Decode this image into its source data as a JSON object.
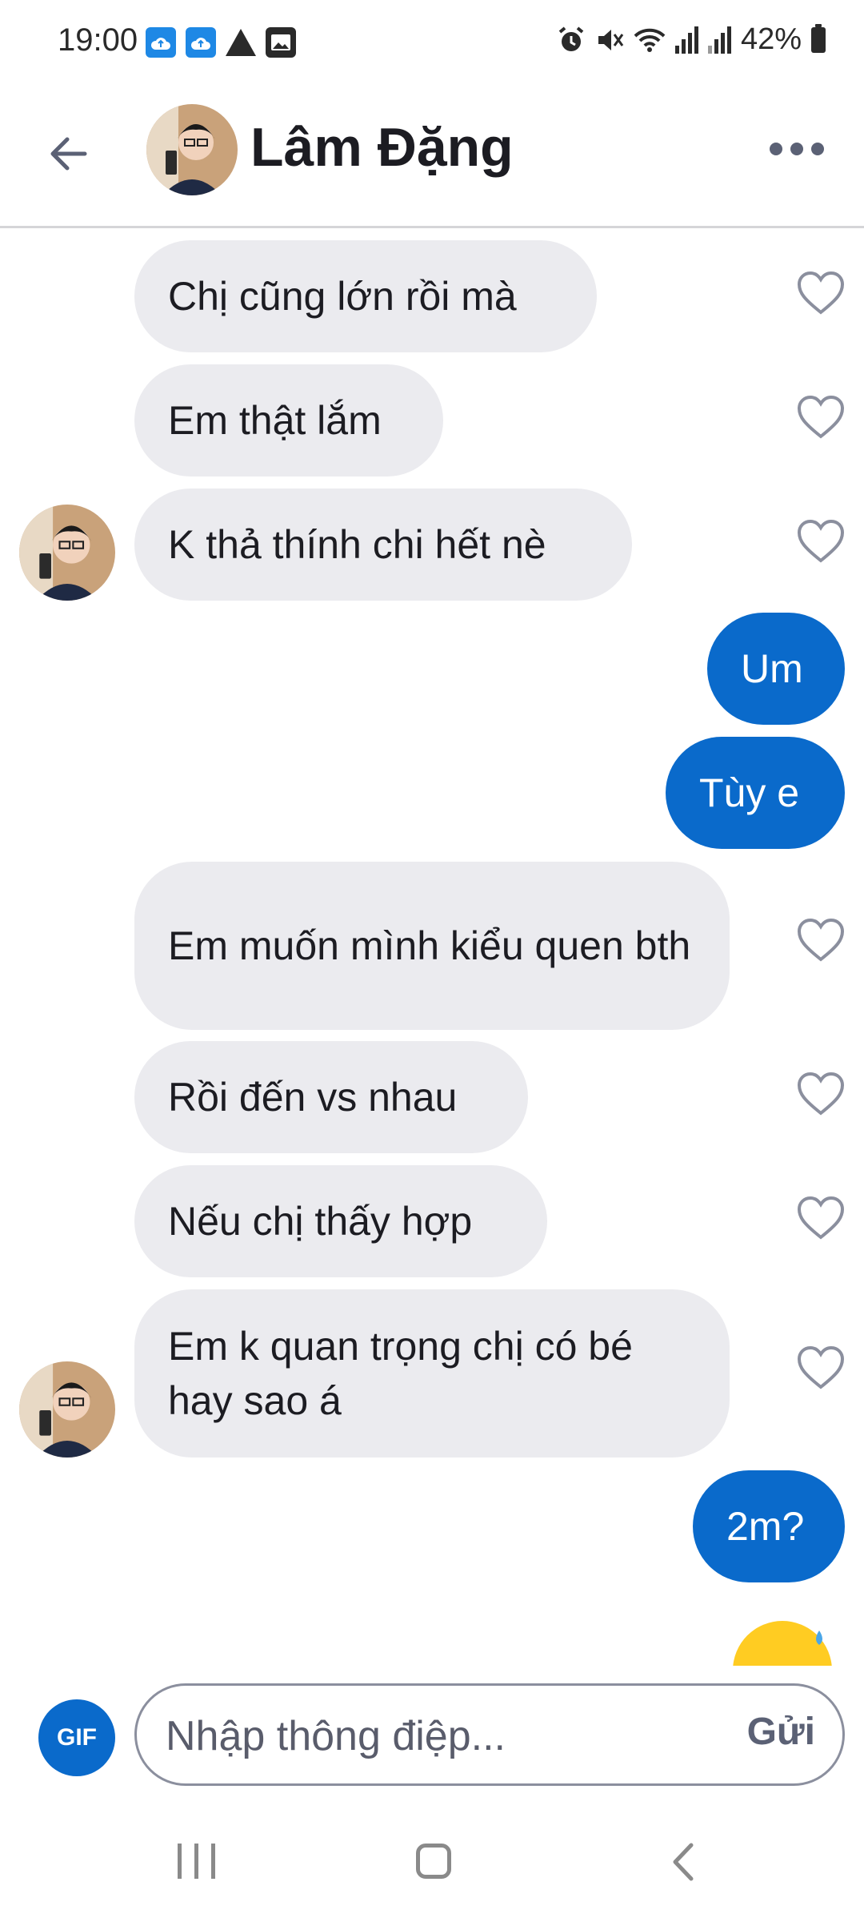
{
  "status_bar": {
    "time": "19:00",
    "battery": "42%",
    "icons": [
      "cloud-upload-icon",
      "cloud-upload-icon",
      "warning-icon",
      "image-icon",
      "alarm-icon",
      "mute-icon",
      "wifi-icon",
      "signal-icon",
      "signal-icon",
      "battery-icon"
    ]
  },
  "header": {
    "back_icon": "back-arrow-icon",
    "contact_name": "Lâm Đặng",
    "more_icon": "more-dots-icon"
  },
  "messages": [
    {
      "side": "in",
      "text": "Chị cũng lớn rồi mà"
    },
    {
      "side": "in",
      "text": "Em thật lắm"
    },
    {
      "side": "in",
      "text": "K thả thính chi hết nè"
    },
    {
      "side": "out",
      "text": "Um"
    },
    {
      "side": "out",
      "text": "Tùy e"
    },
    {
      "side": "in",
      "text": "Em muốn mình kiểu quen bth"
    },
    {
      "side": "in",
      "text": "Rồi đến vs nhau"
    },
    {
      "side": "in",
      "text": "Nếu chị thấy hợp"
    },
    {
      "side": "in",
      "text": "Em k quan trọng chị có bé hay sao á"
    },
    {
      "side": "out",
      "text": "2m?"
    }
  ],
  "composer": {
    "gif_label": "GIF",
    "placeholder": "Nhập thông điệp...",
    "send_label": "Gửi"
  },
  "colors": {
    "accent": "#0a6acb",
    "incoming_bubble": "#ebebef"
  }
}
